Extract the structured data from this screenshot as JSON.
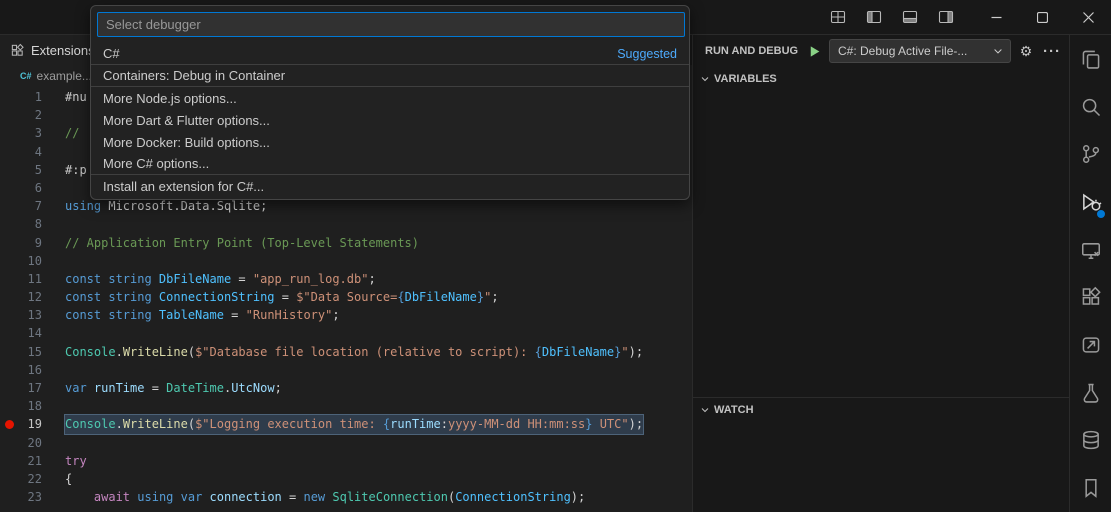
{
  "window": {
    "titlebar_icons": [
      "customize-layout",
      "toggle-sidebar-left",
      "toggle-panel-bottom",
      "toggle-sidebar-right"
    ],
    "controls": [
      "minimize",
      "maximize",
      "close"
    ]
  },
  "quick_pick": {
    "placeholder": "Select debugger",
    "items": [
      {
        "label": "C#",
        "badge": "Suggested",
        "separator_after": true
      },
      {
        "label": "Containers: Debug in Container",
        "separator_after": true
      },
      {
        "label": "More Node.js options..."
      },
      {
        "label": "More Dart & Flutter options..."
      },
      {
        "label": "More Docker: Build options..."
      },
      {
        "label": "More C# options...",
        "separator_after": true
      },
      {
        "label": "Install an extension for C#..."
      }
    ]
  },
  "editor_header": {
    "tab_label": "Extensions",
    "breadcrumb": "example...",
    "file_icon": "C#"
  },
  "debug_panel": {
    "title": "RUN AND DEBUG",
    "config_label": "C#: Debug Active File-...",
    "sections": {
      "variables": "VARIABLES",
      "watch": "WATCH"
    }
  },
  "activity_bar": {
    "icons": [
      "copy-pages",
      "search",
      "source-control",
      "run-and-debug",
      "remote-window",
      "extensions",
      "share",
      "test-beaker",
      "database",
      "bookmark"
    ],
    "active": "run-and-debug",
    "badge_icon": "run-and-debug",
    "badge_color": "#0078d4"
  },
  "editor": {
    "breakpoint_line": 19,
    "active_line": 19,
    "token_colors": {
      "kw": "#569CD6",
      "ctrl": "#C586C0",
      "cls": "#4EC9B0",
      "fn": "#DCDCAA",
      "const": "#4FC1FF",
      "var": "#9CDCFE",
      "str": "#CE9178",
      "com": "#6A9955",
      "pln": "#D4D4D4",
      "dir": "#C8C8C8",
      "ib": "#569CD6"
    },
    "lines": [
      {
        "n": 1,
        "t": [
          [
            "#nu",
            "dir"
          ]
        ]
      },
      {
        "n": 2,
        "t": []
      },
      {
        "n": 3,
        "t": [
          [
            "// ",
            "com"
          ]
        ]
      },
      {
        "n": 4,
        "t": []
      },
      {
        "n": 5,
        "t": [
          [
            "#:p",
            "dir"
          ]
        ]
      },
      {
        "n": 6,
        "t": []
      },
      {
        "n": 7,
        "t": [
          [
            "using ",
            "kw"
          ],
          [
            "Microsoft.Data.Sqlite",
            "pln"
          ],
          [
            ";",
            "pln"
          ]
        ]
      },
      {
        "n": 8,
        "t": []
      },
      {
        "n": 9,
        "t": [
          [
            "// Application Entry Point (Top-Level Statements)",
            "com"
          ]
        ]
      },
      {
        "n": 10,
        "t": []
      },
      {
        "n": 11,
        "t": [
          [
            "const string ",
            "kw"
          ],
          [
            "DbFileName",
            "const"
          ],
          [
            " = ",
            "pln"
          ],
          [
            "\"app_run_log.db\"",
            "str"
          ],
          [
            ";",
            "pln"
          ]
        ]
      },
      {
        "n": 12,
        "t": [
          [
            "const string ",
            "kw"
          ],
          [
            "ConnectionString",
            "const"
          ],
          [
            " = ",
            "pln"
          ],
          [
            "$\"Data Source=",
            "str"
          ],
          [
            "{",
            "ib"
          ],
          [
            "DbFileName",
            "const"
          ],
          [
            "}",
            "ib"
          ],
          [
            "\"",
            "str"
          ],
          [
            ";",
            "pln"
          ]
        ]
      },
      {
        "n": 13,
        "t": [
          [
            "const string ",
            "kw"
          ],
          [
            "TableName",
            "const"
          ],
          [
            " = ",
            "pln"
          ],
          [
            "\"RunHistory\"",
            "str"
          ],
          [
            ";",
            "pln"
          ]
        ]
      },
      {
        "n": 14,
        "t": []
      },
      {
        "n": 15,
        "t": [
          [
            "Console",
            "cls"
          ],
          [
            ".",
            "pln"
          ],
          [
            "WriteLine",
            "fn"
          ],
          [
            "(",
            "pln"
          ],
          [
            "$\"Database file location (relative to script): ",
            "str"
          ],
          [
            "{",
            "ib"
          ],
          [
            "DbFileName",
            "const"
          ],
          [
            "}",
            "ib"
          ],
          [
            "\"",
            "str"
          ],
          [
            ")",
            "pln"
          ],
          [
            ";",
            "pln"
          ]
        ]
      },
      {
        "n": 16,
        "t": []
      },
      {
        "n": 17,
        "t": [
          [
            "var ",
            "kw"
          ],
          [
            "runTime",
            "var"
          ],
          [
            " = ",
            "pln"
          ],
          [
            "DateTime",
            "cls"
          ],
          [
            ".",
            "pln"
          ],
          [
            "UtcNow",
            "var"
          ],
          [
            ";",
            "pln"
          ]
        ]
      },
      {
        "n": 18,
        "t": []
      },
      {
        "n": 19,
        "t": [
          [
            "Console",
            "cls"
          ],
          [
            ".",
            "pln"
          ],
          [
            "WriteLine",
            "fn"
          ],
          [
            "(",
            "pln"
          ],
          [
            "$\"Logging execution time: ",
            "str"
          ],
          [
            "{",
            "ib"
          ],
          [
            "runTime",
            "var"
          ],
          [
            ":",
            "pln"
          ],
          [
            "yyyy-MM-dd HH:mm:ss",
            "str"
          ],
          [
            "}",
            "ib"
          ],
          [
            " UTC\"",
            "str"
          ],
          [
            ")",
            "pln"
          ],
          [
            ";",
            "pln"
          ]
        ]
      },
      {
        "n": 20,
        "t": []
      },
      {
        "n": 21,
        "t": [
          [
            "try",
            "ctrl"
          ]
        ]
      },
      {
        "n": 22,
        "t": [
          [
            "{",
            "pln"
          ]
        ]
      },
      {
        "n": 23,
        "t": [
          [
            "    ",
            "pln"
          ],
          [
            "await ",
            "ctrl"
          ],
          [
            "using ",
            "kw"
          ],
          [
            "var ",
            "kw"
          ],
          [
            "connection",
            "var"
          ],
          [
            " = ",
            "pln"
          ],
          [
            "new ",
            "kw"
          ],
          [
            "SqliteConnection",
            "cls"
          ],
          [
            "(",
            "pln"
          ],
          [
            "ConnectionString",
            "const"
          ],
          [
            ")",
            "pln"
          ],
          [
            ";",
            "pln"
          ]
        ]
      }
    ]
  }
}
